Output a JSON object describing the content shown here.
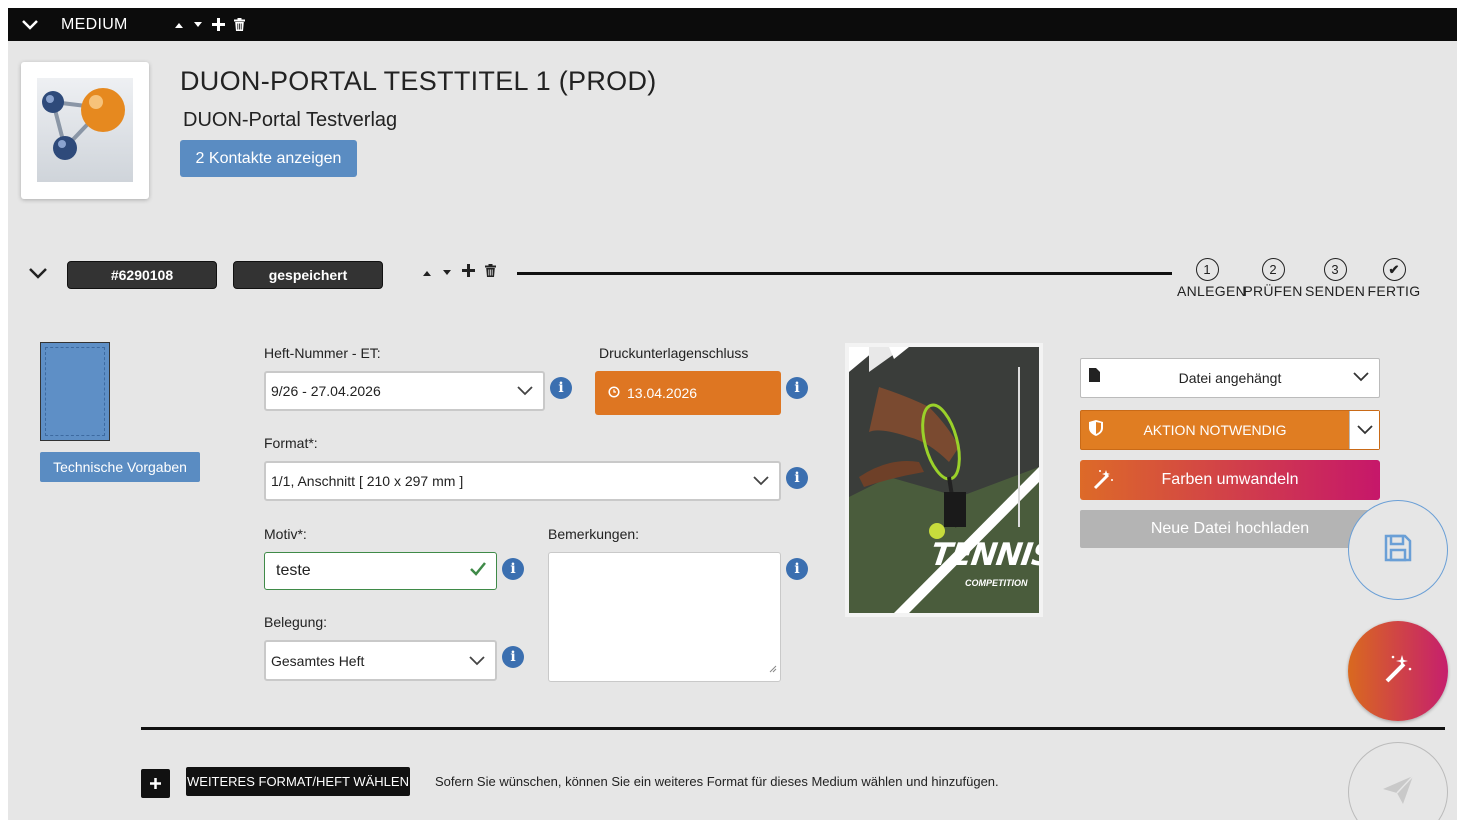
{
  "header": {
    "title": "MEDIUM"
  },
  "medium": {
    "title": "DUON-PORTAL TESTTITEL 1 (PROD)",
    "publisher": "DUON-Portal Testverlag",
    "contacts_button": "2 Kontakte anzeigen"
  },
  "order": {
    "id": "#6290108",
    "status": "gespeichert",
    "steps": [
      {
        "num": "1",
        "label": "ANLEGEN"
      },
      {
        "num": "2",
        "label": "PRÜFEN"
      },
      {
        "num": "3",
        "label": "SENDEN"
      },
      {
        "num": "✔",
        "label": "FERTIG"
      }
    ]
  },
  "left": {
    "tech_button": "Technische Vorgaben"
  },
  "form": {
    "issue_label": "Heft-Nummer - ET:",
    "issue_value": "9/26 - 27.04.2026",
    "deadline_label": "Druckunterlagenschluss",
    "deadline_value": "13.04.2026",
    "format_label": "Format*:",
    "format_value": "1/1, Anschnitt [ 210 x 297 mm ]",
    "motiv_label": "Motiv*:",
    "motiv_value": "teste",
    "remarks_label": "Bemerkungen:",
    "placement_label": "Belegung:",
    "placement_value": "Gesamtes Heft"
  },
  "preview": {
    "headline": "TENNIS",
    "subline": "COMPETITION"
  },
  "actions": {
    "file_status": "Datei angehängt",
    "action_required": "AKTION NOTWENDIG",
    "convert_colors": "Farben umwandeln",
    "upload_new": "Neue Datei hochladen"
  },
  "footer": {
    "more_button": "WEITERES FORMAT/HEFT WÄHLEN",
    "hint": "Sofern Sie wünschen, können Sie ein weiteres Format für dieses Medium wählen und hinzufügen."
  },
  "colors": {
    "accent_blue": "#5a8cc2",
    "orange": "#de7622",
    "magenta": "#c6176a",
    "success": "#3f8a48"
  }
}
